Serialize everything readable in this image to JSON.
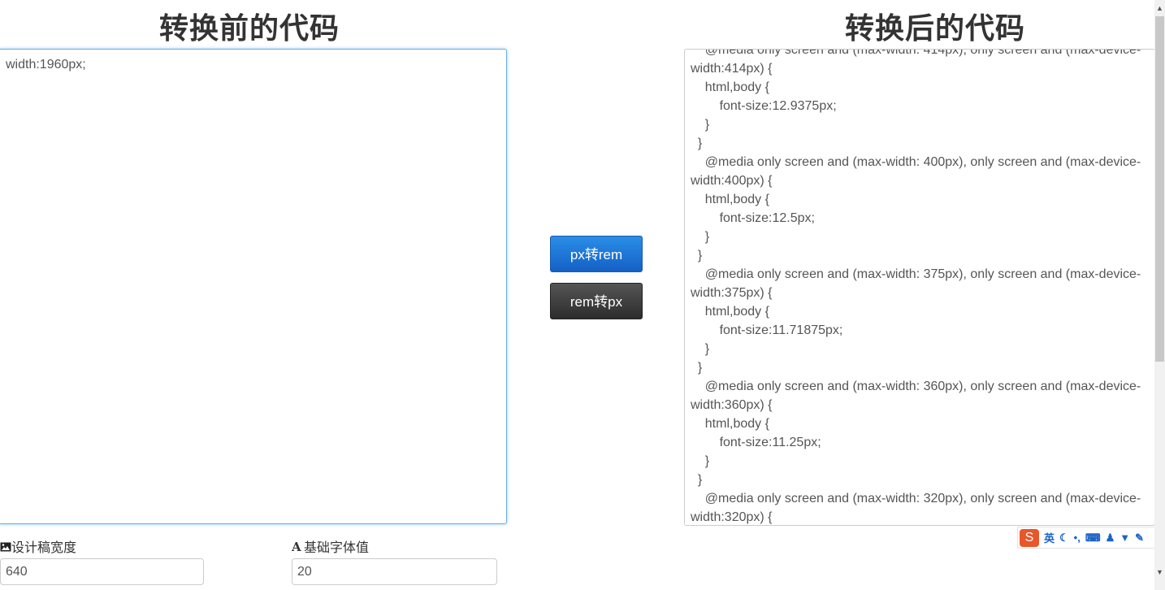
{
  "titles": {
    "before": "转换前的代码",
    "after": "转换后的代码"
  },
  "input_code": "width:1960px;",
  "output_code": "    @media only screen and (max-width: 414px), only screen and (max-device-width:414px) {\n    html,body {\n        font-size:12.9375px;\n    }\n  }\n    @media only screen and (max-width: 400px), only screen and (max-device-width:400px) {\n    html,body {\n        font-size:12.5px;\n    }\n  }\n    @media only screen and (max-width: 375px), only screen and (max-device-width:375px) {\n    html,body {\n        font-size:11.71875px;\n    }\n  }\n    @media only screen and (max-width: 360px), only screen and (max-device-width:360px) {\n    html,body {\n        font-size:11.25px;\n    }\n  }\n    @media only screen and (max-width: 320px), only screen and (max-device-width:320px) {",
  "buttons": {
    "px_to_rem": "px转rem",
    "rem_to_px": "rem转px"
  },
  "fields": {
    "design_width_label": "设计稿宽度",
    "design_width_value": "640",
    "base_font_label": "基础字体值",
    "base_font_value": "20"
  },
  "ime": {
    "lang": "英",
    "icons": [
      "sogou-logo-icon",
      "moon-icon",
      "punctuation-icon",
      "keyboard-icon",
      "user-icon",
      "shirt-icon",
      "wrench-icon"
    ]
  }
}
